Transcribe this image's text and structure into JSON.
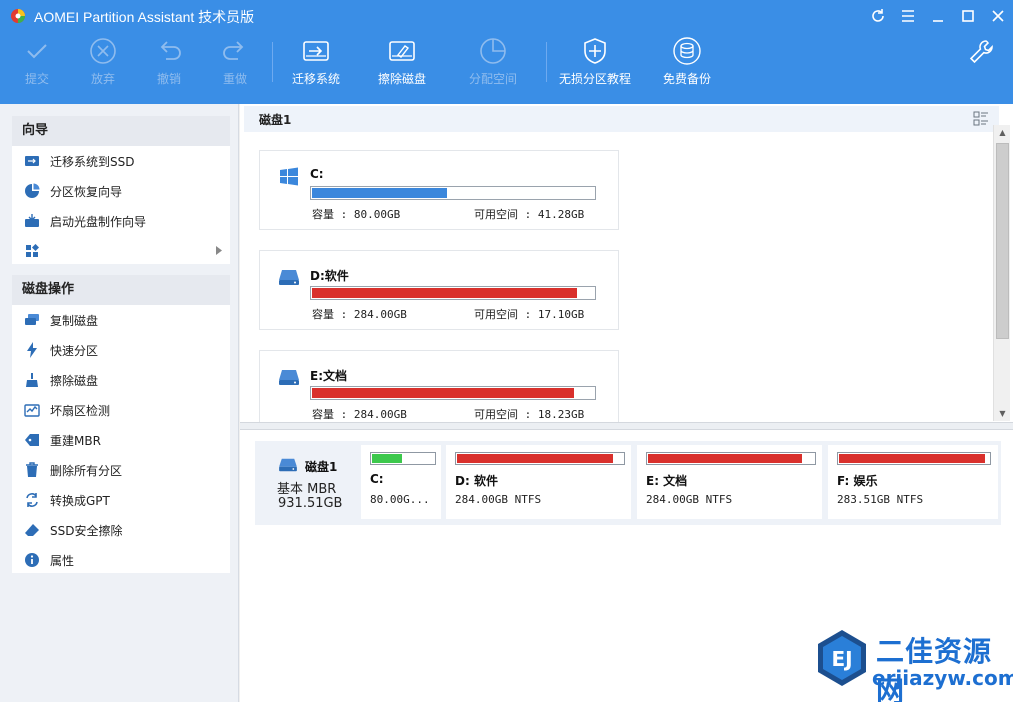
{
  "window": {
    "title": "AOMEI Partition Assistant 技术员版"
  },
  "toolbar": {
    "apply": "提交",
    "discard": "放弃",
    "undo": "撤销",
    "redo": "重做",
    "migrate_os": "迁移系统",
    "wipe_disk": "擦除磁盘",
    "allocate_space": "分配空间",
    "lossless_tutorial": "无损分区教程",
    "free_backup": "免费备份"
  },
  "sidebar": {
    "wizard_title": "向导",
    "wizard_items": [
      {
        "label": "迁移系统到SSD",
        "icon": "migrate-ssd-icon"
      },
      {
        "label": "分区恢复向导",
        "icon": "pie-recovery-icon"
      },
      {
        "label": "启动光盘制作向导",
        "icon": "boot-disc-icon"
      }
    ],
    "disk_ops_title": "磁盘操作",
    "disk_ops_items": [
      {
        "label": "复制磁盘",
        "icon": "copy-disk-icon"
      },
      {
        "label": "快速分区",
        "icon": "lightning-icon"
      },
      {
        "label": "擦除磁盘",
        "icon": "broom-icon"
      },
      {
        "label": "坏扇区检测",
        "icon": "sector-check-icon"
      },
      {
        "label": "重建MBR",
        "icon": "tag-icon"
      },
      {
        "label": "删除所有分区",
        "icon": "trash-icon"
      },
      {
        "label": "转换成GPT",
        "icon": "convert-icon"
      },
      {
        "label": "SSD安全擦除",
        "icon": "eraser-icon"
      },
      {
        "label": "属性",
        "icon": "info-icon"
      }
    ]
  },
  "disk_panel": {
    "title": "磁盘1",
    "partitions": [
      {
        "name": "C:",
        "capacity": "容量 : 80.00GB",
        "free": "可用空间 : 41.28GB",
        "used_fraction": 0.48,
        "color": "#3b87dc",
        "icon": "windows-icon"
      },
      {
        "name": "D:软件",
        "capacity": "容量 : 284.00GB",
        "free": "可用空间 : 17.10GB",
        "used_fraction": 0.94,
        "color": "#d9302c",
        "icon": "drive-icon"
      },
      {
        "name": "E:文档",
        "capacity": "容量 : 284.00GB",
        "free": "可用空间 : 18.23GB",
        "used_fraction": 0.93,
        "color": "#d9302c",
        "icon": "drive-icon"
      }
    ]
  },
  "disk_map": {
    "disk_name": "磁盘1",
    "disk_type": "基本 MBR",
    "disk_size": "931.51GB",
    "partitions": [
      {
        "label": "C:",
        "detail": "80.00G...",
        "used_fraction": 0.48,
        "color": "#3cc84c"
      },
      {
        "label": "D: 软件",
        "detail": "284.00GB NTFS",
        "used_fraction": 0.94,
        "color": "#d9302c"
      },
      {
        "label": "E: 文档",
        "detail": "284.00GB NTFS",
        "used_fraction": 0.93,
        "color": "#d9302c"
      },
      {
        "label": "F: 娱乐",
        "detail": "283.51GB NTFS",
        "used_fraction": 0.97,
        "color": "#d9302c"
      }
    ]
  },
  "watermark": {
    "badge": "EJ",
    "cn": "二佳资源网",
    "en": "erjiazyw.com"
  },
  "colors": {
    "header": "#3a8ee6",
    "used_blue": "#3b87dc",
    "used_red": "#d9302c",
    "used_green": "#3cc84c"
  }
}
